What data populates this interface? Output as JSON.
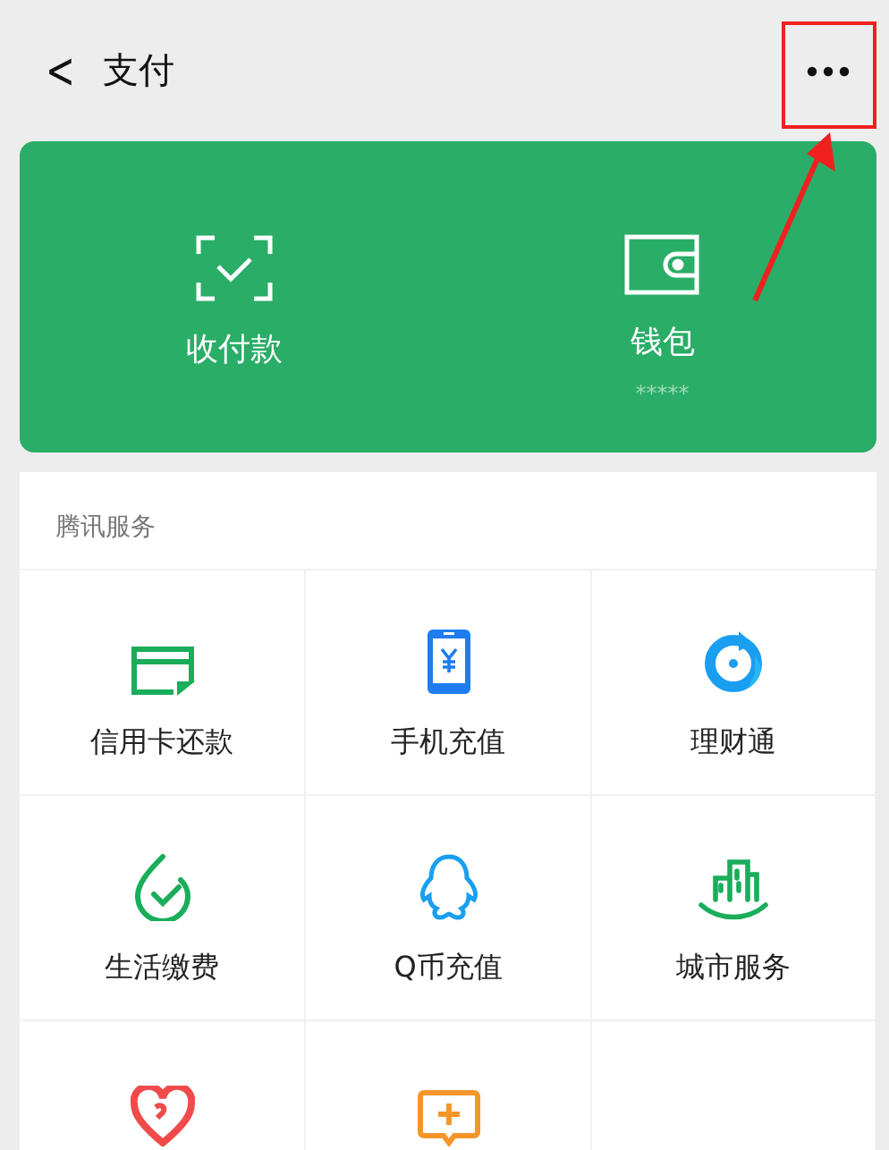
{
  "header": {
    "back": "<",
    "title": "支付",
    "more_highlighted": true
  },
  "wallet_card": {
    "actions": [
      {
        "kind": "scan",
        "label": "收付款"
      },
      {
        "kind": "wallet",
        "label": "钱包",
        "balance": "*****"
      }
    ]
  },
  "services": {
    "title": "腾讯服务",
    "items": [
      {
        "kind": "card",
        "label": "信用卡还款"
      },
      {
        "kind": "phone",
        "label": "手机充值"
      },
      {
        "kind": "wealth",
        "label": "理财通"
      },
      {
        "kind": "drop",
        "label": "生活缴费"
      },
      {
        "kind": "penguin",
        "label": "Q币充值"
      },
      {
        "kind": "city",
        "label": "城市服务"
      },
      {
        "kind": "heart"
      },
      {
        "kind": "chat"
      },
      {
        "kind": "empty"
      }
    ]
  }
}
